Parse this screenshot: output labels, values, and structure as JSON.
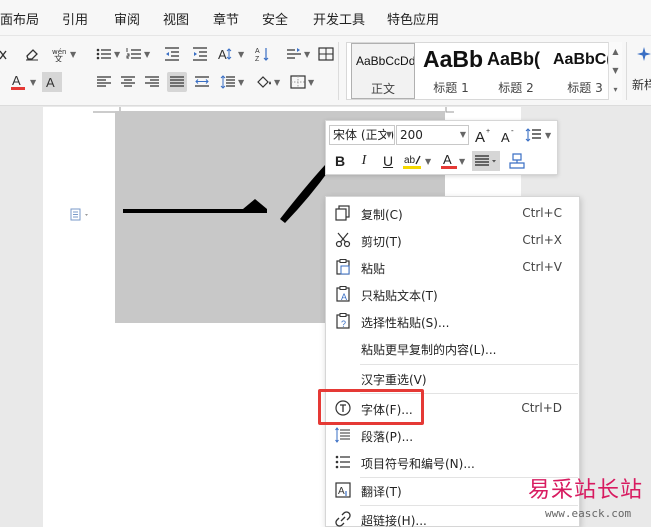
{
  "menu": {
    "items": [
      "面布局",
      "引用",
      "审阅",
      "视图",
      "章节",
      "安全",
      "开发工具",
      "特色应用"
    ]
  },
  "ribbon": {
    "styles": [
      {
        "preview": "AaBbCcDd",
        "name": "正文"
      },
      {
        "preview": "AaBb",
        "name": "标题 1"
      },
      {
        "preview": "AaBb(",
        "name": "标题 2"
      },
      {
        "preview": "AaBbC(",
        "name": "标题 3"
      }
    ],
    "new_style_label": "新样"
  },
  "mini_toolbar": {
    "font_name": "宋体 (正文)",
    "font_size": "200",
    "bold": "B",
    "italic": "I",
    "underline": "U"
  },
  "document": {
    "large_text": "一个"
  },
  "context_menu": {
    "items": [
      {
        "label": "复制(C)",
        "shortcut": "Ctrl+C",
        "icon": "copy-icon"
      },
      {
        "label": "剪切(T)",
        "shortcut": "Ctrl+X",
        "icon": "scissors-icon"
      },
      {
        "label": "粘贴",
        "shortcut": "Ctrl+V",
        "icon": "paste-icon"
      },
      {
        "label": "只粘贴文本(T)",
        "shortcut": "",
        "icon": "paste-text-icon"
      },
      {
        "label": "选择性粘贴(S)...",
        "shortcut": "",
        "icon": "paste-special-icon"
      },
      {
        "label": "粘贴更早复制的内容(L)...",
        "shortcut": "",
        "icon": ""
      },
      {
        "label": "汉字重选(V)",
        "shortcut": "",
        "icon": ""
      },
      {
        "label": "字体(F)...",
        "shortcut": "Ctrl+D",
        "icon": "font-icon"
      },
      {
        "label": "段落(P)...",
        "shortcut": "",
        "icon": "paragraph-icon"
      },
      {
        "label": "项目符号和编号(N)...",
        "shortcut": "",
        "icon": "bullets-icon"
      },
      {
        "label": "翻译(T)",
        "shortcut": "",
        "icon": "translate-icon"
      },
      {
        "label": "超链接(H)...",
        "shortcut": "",
        "icon": "hyperlink-icon"
      }
    ]
  },
  "watermark": {
    "main": "易采站长站",
    "sub": "www.easck.com"
  },
  "colors": {
    "highlight": "#e53935",
    "font_color_bar": "#e53935",
    "watermark": "#d81b60"
  }
}
